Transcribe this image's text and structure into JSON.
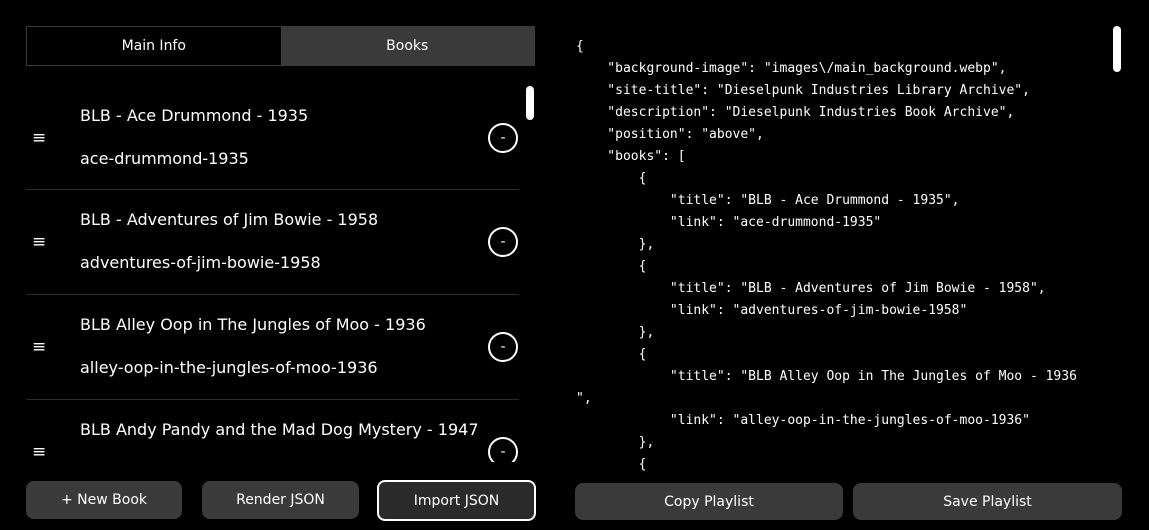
{
  "tabs": [
    {
      "label": "Main Info",
      "active": false
    },
    {
      "label": "Books",
      "active": true
    }
  ],
  "books": [
    {
      "title": "BLB - Ace Drummond - 1935",
      "link": "ace-drummond-1935"
    },
    {
      "title": "BLB - Adventures of Jim Bowie - 1958",
      "link": "adventures-of-jim-bowie-1958"
    },
    {
      "title": "BLB Alley Oop in The Jungles of Moo - 1936",
      "link": "alley-oop-in-the-jungles-of-moo-1936"
    },
    {
      "title": "BLB Andy Pandy and the Mad Dog Mystery - 1947",
      "link": ""
    }
  ],
  "icons": {
    "handle": "≡",
    "remove": "-"
  },
  "buttons": {
    "new_book": "+ New Book",
    "render_json": "Render JSON",
    "import_json": "Import JSON",
    "copy_playlist": "Copy Playlist",
    "save_playlist": "Save Playlist"
  },
  "json_lines": [
    "{",
    "    \"background-image\": \"images\\/main_background.webp\",",
    "    \"site-title\": \"Dieselpunk Industries Library Archive\",",
    "    \"description\": \"Dieselpunk Industries Book Archive\",",
    "    \"position\": \"above\",",
    "    \"books\": [",
    "        {",
    "            \"title\": \"BLB - Ace Drummond - 1935\",",
    "            \"link\": \"ace-drummond-1935\"",
    "        },",
    "        {",
    "            \"title\": \"BLB - Adventures of Jim Bowie - 1958\",",
    "            \"link\": \"adventures-of-jim-bowie-1958\"",
    "        },",
    "        {",
    "            \"title\": \"BLB Alley Oop in The Jungles of Moo - 1936",
    "\",",
    "            \"link\": \"alley-oop-in-the-jungles-of-moo-1936\"",
    "        },",
    "        {"
  ],
  "colors": {
    "panel": "#3a3a3a",
    "background": "#000000",
    "text": "#ffffff"
  }
}
